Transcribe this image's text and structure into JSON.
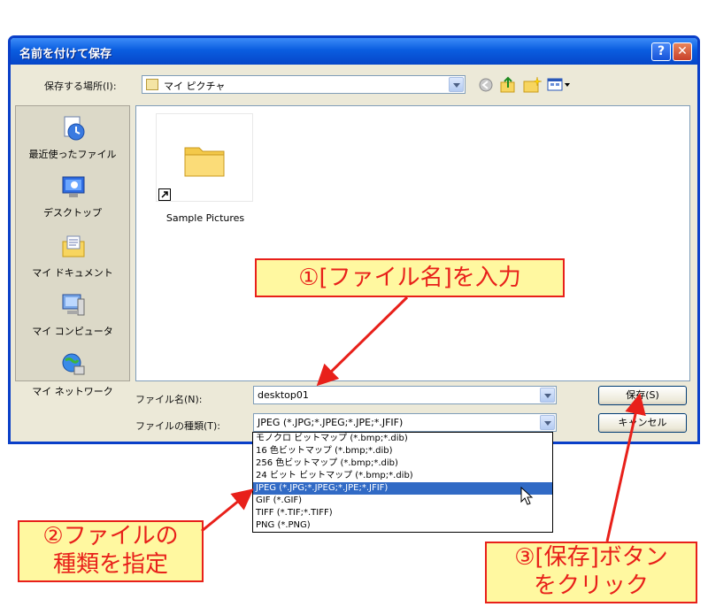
{
  "dialog": {
    "title": "名前を付けて保存",
    "help_glyph": "?",
    "close_glyph": "✕"
  },
  "location": {
    "label": "保存する場所(I):",
    "value": "マイ ピクチャ",
    "icons": [
      "back-icon",
      "up-folder-icon",
      "new-folder-icon",
      "view-menu-icon"
    ]
  },
  "places": [
    {
      "label": "最近使ったファイル",
      "icon": "recent-documents-icon"
    },
    {
      "label": "デスクトップ",
      "icon": "desktop-icon"
    },
    {
      "label": "マイ ドキュメント",
      "icon": "my-documents-icon"
    },
    {
      "label": "マイ コンピュータ",
      "icon": "my-computer-icon"
    },
    {
      "label": "マイ ネットワーク",
      "icon": "my-network-icon"
    }
  ],
  "files": [
    {
      "name": "Sample Pictures",
      "icon": "folder-shortcut-icon"
    }
  ],
  "filename": {
    "label": "ファイル名(N):",
    "value": "desktop01"
  },
  "filetype": {
    "label": "ファイルの種類(T):",
    "value": "JPEG (*.JPG;*.JPEG;*.JPE;*.JFIF)",
    "options": [
      "モノクロ ビットマップ (*.bmp;*.dib)",
      "16 色ビットマップ (*.bmp;*.dib)",
      "256 色ビットマップ (*.bmp;*.dib)",
      "24 ビット ビットマップ (*.bmp;*.dib)",
      "JPEG (*.JPG;*.JPEG;*.JPE;*.JFIF)",
      "GIF (*.GIF)",
      "TIFF (*.TIF;*.TIFF)",
      "PNG (*.PNG)"
    ],
    "selected_index": 4
  },
  "buttons": {
    "save": "保存(S)",
    "cancel": "キャンセル"
  },
  "callouts": {
    "step1": "①[ファイル名]を入力",
    "step2_line1": "②ファイルの",
    "step2_line2": "種類を指定",
    "step3_line1": "③[保存]ボタン",
    "step3_line2": "をクリック"
  },
  "colors": {
    "titlebar": "#0a5de0",
    "dialog_bg": "#ece9d8",
    "selection": "#316ac5",
    "callout_fill": "#fff8a0",
    "callout_text": "#e8201a"
  }
}
